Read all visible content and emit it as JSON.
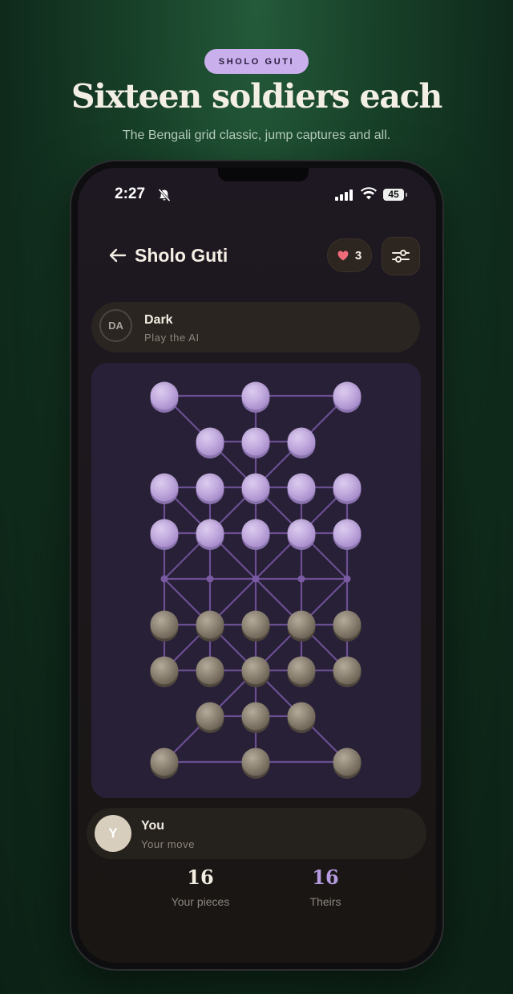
{
  "promo": {
    "tag": "SHOLO GUTI",
    "headline": "Sixteen soldiers each",
    "subline": "The Bengali grid classic, jump captures and all."
  },
  "status_bar": {
    "time": "2:27",
    "battery": "45"
  },
  "header": {
    "title": "Sholo Guti",
    "likes": "3"
  },
  "opponent": {
    "avatar": "DA",
    "name": "Dark",
    "status": "Play the AI"
  },
  "player": {
    "avatar": "Y",
    "name": "You",
    "status": "Your move"
  },
  "stats": {
    "your_pieces": "16",
    "your_label": "Your pieces",
    "their_pieces": "16",
    "their_label": "Theirs"
  },
  "colors": {
    "accent": "#c9b0ec",
    "light_piece": "#cbb6e6",
    "dark_piece": "#9a8f7f",
    "board": "#272037",
    "heart": "#ef6b7a"
  },
  "icons": [
    "back-arrow-icon",
    "heart-icon",
    "sliders-icon",
    "bell-off-icon",
    "signal-icon",
    "wifi-icon",
    "battery-icon"
  ],
  "board_state": {
    "rows": [
      [
        "L",
        "L",
        "L"
      ],
      [
        "L",
        "L",
        "L"
      ],
      [
        "L",
        "L",
        "L",
        "L",
        "L"
      ],
      [
        "L",
        "L",
        "L",
        "L",
        "L"
      ],
      [
        ".",
        ".",
        ".",
        ".",
        "."
      ],
      [
        "D",
        "D",
        "D",
        "D",
        "D"
      ],
      [
        "D",
        "D",
        "D",
        "D",
        "D"
      ],
      [
        "D",
        "D",
        "D"
      ],
      [
        "D",
        "D",
        "D"
      ]
    ]
  }
}
